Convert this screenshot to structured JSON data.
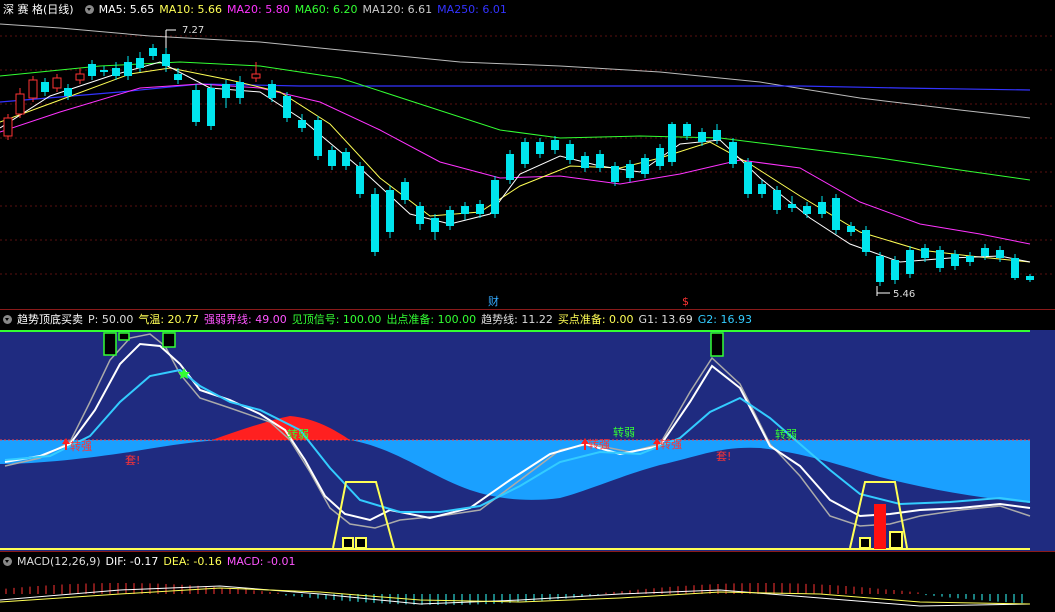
{
  "header": {
    "title": "深 赛 格(日线)",
    "ma": [
      {
        "label": "MA5: 5.65",
        "color": "#ffffff"
      },
      {
        "label": "MA10: 5.66",
        "color": "#ffff55"
      },
      {
        "label": "MA20: 5.80",
        "color": "#ff33ff"
      },
      {
        "label": "MA60: 6.20",
        "color": "#33ff33"
      },
      {
        "label": "MA120: 6.61",
        "color": "#cccccc"
      },
      {
        "label": "MA250: 6.01",
        "color": "#3333ff"
      }
    ]
  },
  "price_chart": {
    "high_label": "7.27",
    "low_label": "5.46",
    "markers": [
      {
        "text": "财",
        "color": "#33aaff"
      },
      {
        "text": "$",
        "color": "#ff3333"
      }
    ]
  },
  "indicator": {
    "name": "趋势顶底买卖",
    "params": [
      {
        "label": "P: 50.00",
        "color": "#dddddd"
      },
      {
        "label": "气温: 20.77",
        "color": "#ffff55"
      },
      {
        "label": "强弱界线: 49.00",
        "color": "#ff55ff"
      },
      {
        "label": "见顶信号: 100.00",
        "color": "#33ff33"
      },
      {
        "label": "出点准备: 100.00",
        "color": "#33ff33"
      },
      {
        "label": "趋势线: 11.22",
        "color": "#dddddd"
      },
      {
        "label": "买点准备: 0.00",
        "color": "#ffff55"
      },
      {
        "label": "G1: 13.69",
        "color": "#dddddd"
      },
      {
        "label": "G2: 16.93",
        "color": "#33ccff"
      }
    ],
    "annotations": [
      {
        "text": "转强",
        "color": "#ff3333"
      },
      {
        "text": "套!",
        "color": "#ff3333"
      },
      {
        "text": "转弱",
        "color": "#33ff33"
      },
      {
        "text": "转强",
        "color": "#ff3333"
      },
      {
        "text": "转弱",
        "color": "#33ff33"
      },
      {
        "text": "转强",
        "color": "#ff3333"
      },
      {
        "text": "套!",
        "color": "#ff3333"
      },
      {
        "text": "转弱",
        "color": "#33ff33"
      }
    ]
  },
  "macd": {
    "name": "MACD(12,26,9)",
    "dif": "DIF: -0.17",
    "dea": "DEA: -0.16",
    "macd": "MACD: -0.01"
  }
}
